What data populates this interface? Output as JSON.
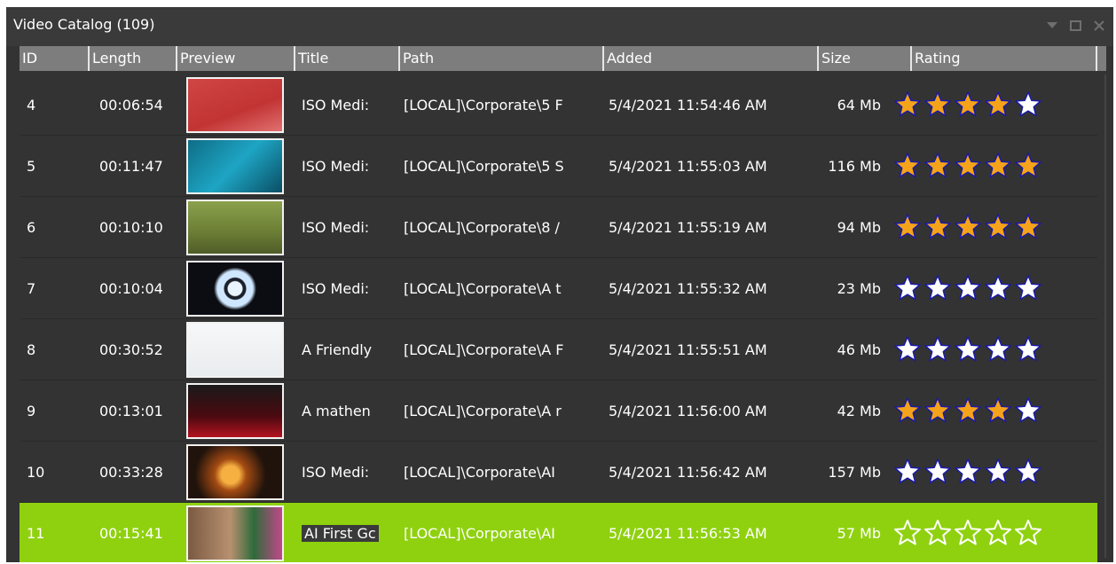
{
  "window": {
    "title": "Video Catalog (109)",
    "controls": [
      "dropdown-icon",
      "maximize-icon",
      "close-icon"
    ]
  },
  "columns": [
    "ID",
    "Length",
    "Preview",
    "Title",
    "Path",
    "Added",
    "Size",
    "Rating"
  ],
  "rows": [
    {
      "id": "4",
      "length": "00:06:54",
      "title": "ISO Medi:",
      "path": "[LOCAL]\\Corporate\\5 F",
      "added": "5/4/2021 11:54:46 AM",
      "size": "64 Mb",
      "rating": 4,
      "selected": false
    },
    {
      "id": "5",
      "length": "00:11:47",
      "title": "ISO Medi:",
      "path": "[LOCAL]\\Corporate\\5 S",
      "added": "5/4/2021 11:55:03 AM",
      "size": "116 Mb",
      "rating": 5,
      "selected": false
    },
    {
      "id": "6",
      "length": "00:10:10",
      "title": "ISO Medi:",
      "path": "[LOCAL]\\Corporate\\8 /",
      "added": "5/4/2021 11:55:19 AM",
      "size": "94 Mb",
      "rating": 5,
      "selected": false
    },
    {
      "id": "7",
      "length": "00:10:04",
      "title": "ISO Medi:",
      "path": "[LOCAL]\\Corporate\\A t",
      "added": "5/4/2021 11:55:32 AM",
      "size": "23 Mb",
      "rating": 0,
      "selected": false
    },
    {
      "id": "8",
      "length": "00:30:52",
      "title": "A Friendly",
      "path": "[LOCAL]\\Corporate\\A F",
      "added": "5/4/2021 11:55:51 AM",
      "size": "46 Mb",
      "rating": 0,
      "selected": false
    },
    {
      "id": "9",
      "length": "00:13:01",
      "title": "A mathen",
      "path": "[LOCAL]\\Corporate\\A r",
      "added": "5/4/2021 11:56:00 AM",
      "size": "42 Mb",
      "rating": 4,
      "selected": false
    },
    {
      "id": "10",
      "length": "00:33:28",
      "title": "ISO Medi:",
      "path": "[LOCAL]\\Corporate\\AI",
      "added": "5/4/2021 11:56:42 AM",
      "size": "157 Mb",
      "rating": 0,
      "selected": false
    },
    {
      "id": "11",
      "length": "00:15:41",
      "title": "AI First Gc",
      "path": "[LOCAL]\\Corporate\\AI",
      "added": "5/4/2021 11:56:53 AM",
      "size": "57 Mb",
      "rating": 0,
      "selected": true
    }
  ],
  "colors": {
    "window_bg": "#333333",
    "header_bg": "#7d7d7d",
    "selected_row": "#8fd10f",
    "star_filled": "#f5a31a",
    "star_empty": "#ffffff",
    "star_outline": "#1a1aa6"
  }
}
